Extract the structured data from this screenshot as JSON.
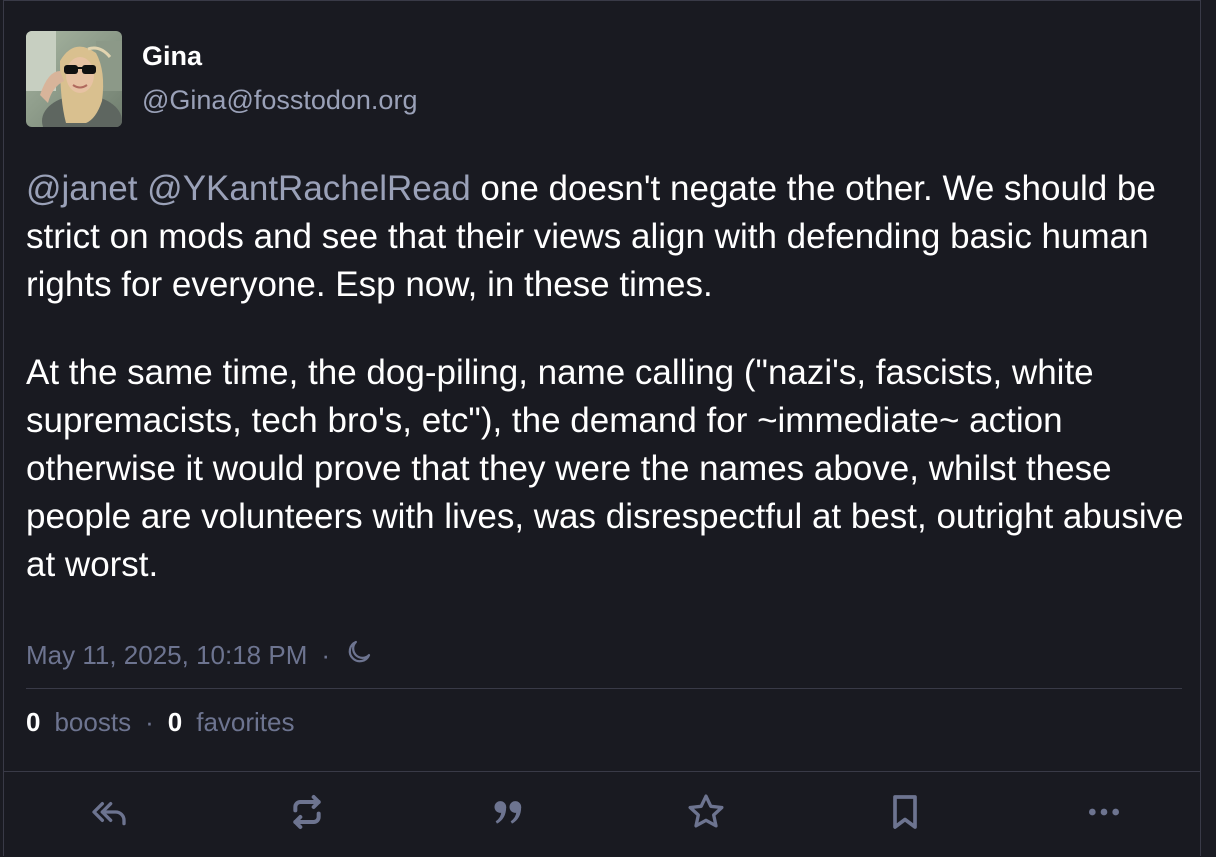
{
  "status": {
    "author": {
      "display_name": "Gina",
      "acct": "@Gina@fosstodon.org"
    },
    "content": {
      "paragraph1": {
        "mention1": "@janet",
        "mention2": "@YKantRachelRead",
        "text": " one doesn't negate the other. We should be strict on mods and see that their views align with defending basic human rights for everyone. Esp now, in these times."
      },
      "paragraph2": "At the same time, the dog-piling, name calling (\"nazi's, fascists, white supremacists, tech bro's, etc\"), the demand for ~immediate~ action otherwise it would prove that they were the names above, whilst these people are volunteers with lives, was disrespectful at best, outright abusive at worst."
    },
    "timestamp": "May 11, 2025, 10:18 PM",
    "meta_separator": "·",
    "visibility_icon": "moon-icon",
    "counts": {
      "boosts_count": "0",
      "boosts_label": "boosts",
      "separator": "·",
      "favorites_count": "0",
      "favorites_label": "favorites"
    }
  },
  "actions": [
    {
      "name": "reply-all-icon"
    },
    {
      "name": "boost-icon"
    },
    {
      "name": "quote-icon"
    },
    {
      "name": "star-icon"
    },
    {
      "name": "bookmark-icon"
    },
    {
      "name": "more-icon"
    }
  ],
  "colors": {
    "background": "#191a21",
    "muted": "#9aa1b8",
    "dim": "#6d7490",
    "border": "#393a47"
  }
}
